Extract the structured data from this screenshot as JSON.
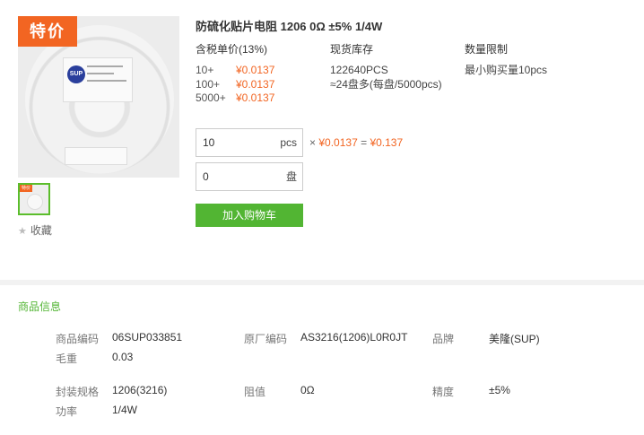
{
  "product": {
    "badge": "特价",
    "thumb_badge": "特价",
    "title": "防硫化贴片电阻 1206 0Ω ±5% 1/4W",
    "favorite_label": "收藏",
    "image_logo": "SUP"
  },
  "pricing": {
    "header": "含税单价(13%)",
    "tiers": [
      {
        "qty": "10+",
        "price": "¥0.0137"
      },
      {
        "qty": "100+",
        "price": "¥0.0137"
      },
      {
        "qty": "5000+",
        "price": "¥0.0137"
      }
    ]
  },
  "stock": {
    "header": "现货库存",
    "count": "122640PCS",
    "reels": "≈24盘多(每盘/5000pcs)"
  },
  "limit": {
    "header": "数量限制",
    "text": "最小购买量10pcs"
  },
  "order": {
    "qty_value": "10",
    "qty_unit": "pcs",
    "reel_value": "0",
    "reel_unit": "盘",
    "times": "×",
    "unit_price": "¥0.0137",
    "equals": "=",
    "total": "¥0.137",
    "add_to_cart": "加入购物车"
  },
  "info": {
    "section_title": "商品信息",
    "rows": [
      {
        "k1": "商品编码",
        "v1": "06SUP033851",
        "k2": "原厂编码",
        "v2": "AS3216(1206)L0R0JT",
        "k3": "品牌",
        "v3": "美隆(SUP)"
      },
      {
        "k1": "毛重",
        "v1": "0.03"
      },
      {
        "k1": "封装规格",
        "v1": "1206(3216)",
        "k2": "阻值",
        "v2": "0Ω",
        "k3": "精度",
        "v3": "±5%"
      },
      {
        "k1": "功率",
        "v1": "1/4W"
      }
    ]
  },
  "colors": {
    "accent_orange": "#f26522",
    "accent_green": "#52b533"
  }
}
